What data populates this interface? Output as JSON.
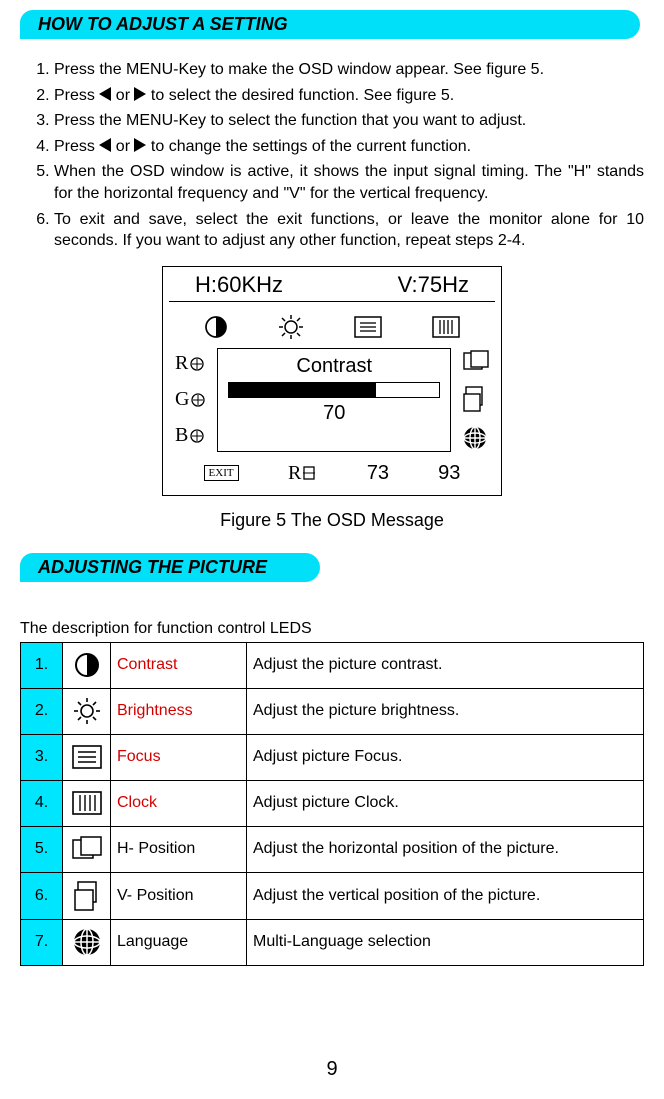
{
  "section1": {
    "title": "HOW TO ADJUST A SETTING"
  },
  "steps": [
    "Press the MENU-Key  to make the OSD window appear. See figure 5.",
    "Press  [LEFT]  or  [RIGHT] to select the desired function. See figure 5.",
    "Press the MENU-Key  to select the function that you want to adjust.",
    "Press  [LEFT]  or  [RIGHT] to change the settings of the current function.",
    "When the OSD window is active, it shows the input signal timing. The  \"H\" stands for the horizontal frequency and \"V\" for the vertical frequency.",
    "To exit and save, select the exit functions, or leave the monitor alone for 10 seconds. If you want to adjust any other function, repeat steps 2-4."
  ],
  "osd": {
    "h_label": "H:60KHz",
    "v_label": "V:75Hz",
    "center_label": "Contrast",
    "center_value": "70",
    "rgb": {
      "r": "R",
      "g": "G",
      "b": "B"
    },
    "exit": "EXIT",
    "bottom_nums": {
      "a": "73",
      "b": "93"
    }
  },
  "fig_caption": "Figure 5     The  OSD  Message",
  "section2": {
    "title": "ADJUSTING THE PICTURE"
  },
  "table_intro": "The description for function control LEDS",
  "rows": [
    {
      "n": "1.",
      "name": "Contrast",
      "desc": "Adjust the picture contrast.",
      "red": true,
      "icon": "contrast"
    },
    {
      "n": "2.",
      "name": "Brightness",
      "desc": "Adjust the picture brightness.",
      "red": true,
      "icon": "brightness"
    },
    {
      "n": "3.",
      "name": "Focus",
      "desc": "Adjust picture Focus.",
      "red": true,
      "icon": "focus"
    },
    {
      "n": "4.",
      "name": "Clock",
      "desc": "Adjust picture Clock.",
      "red": true,
      "icon": "clock"
    },
    {
      "n": "5.",
      "name": "H- Position",
      "desc": "Adjust the horizontal position of the picture.",
      "red": false,
      "icon": "hpos"
    },
    {
      "n": "6.",
      "name": "V- Position",
      "desc": "Adjust the vertical position of the picture.",
      "red": false,
      "icon": "vpos"
    },
    {
      "n": "7.",
      "name": "Language",
      "desc": "Multi-Language selection",
      "red": false,
      "icon": "globe"
    }
  ],
  "page_number": "9"
}
